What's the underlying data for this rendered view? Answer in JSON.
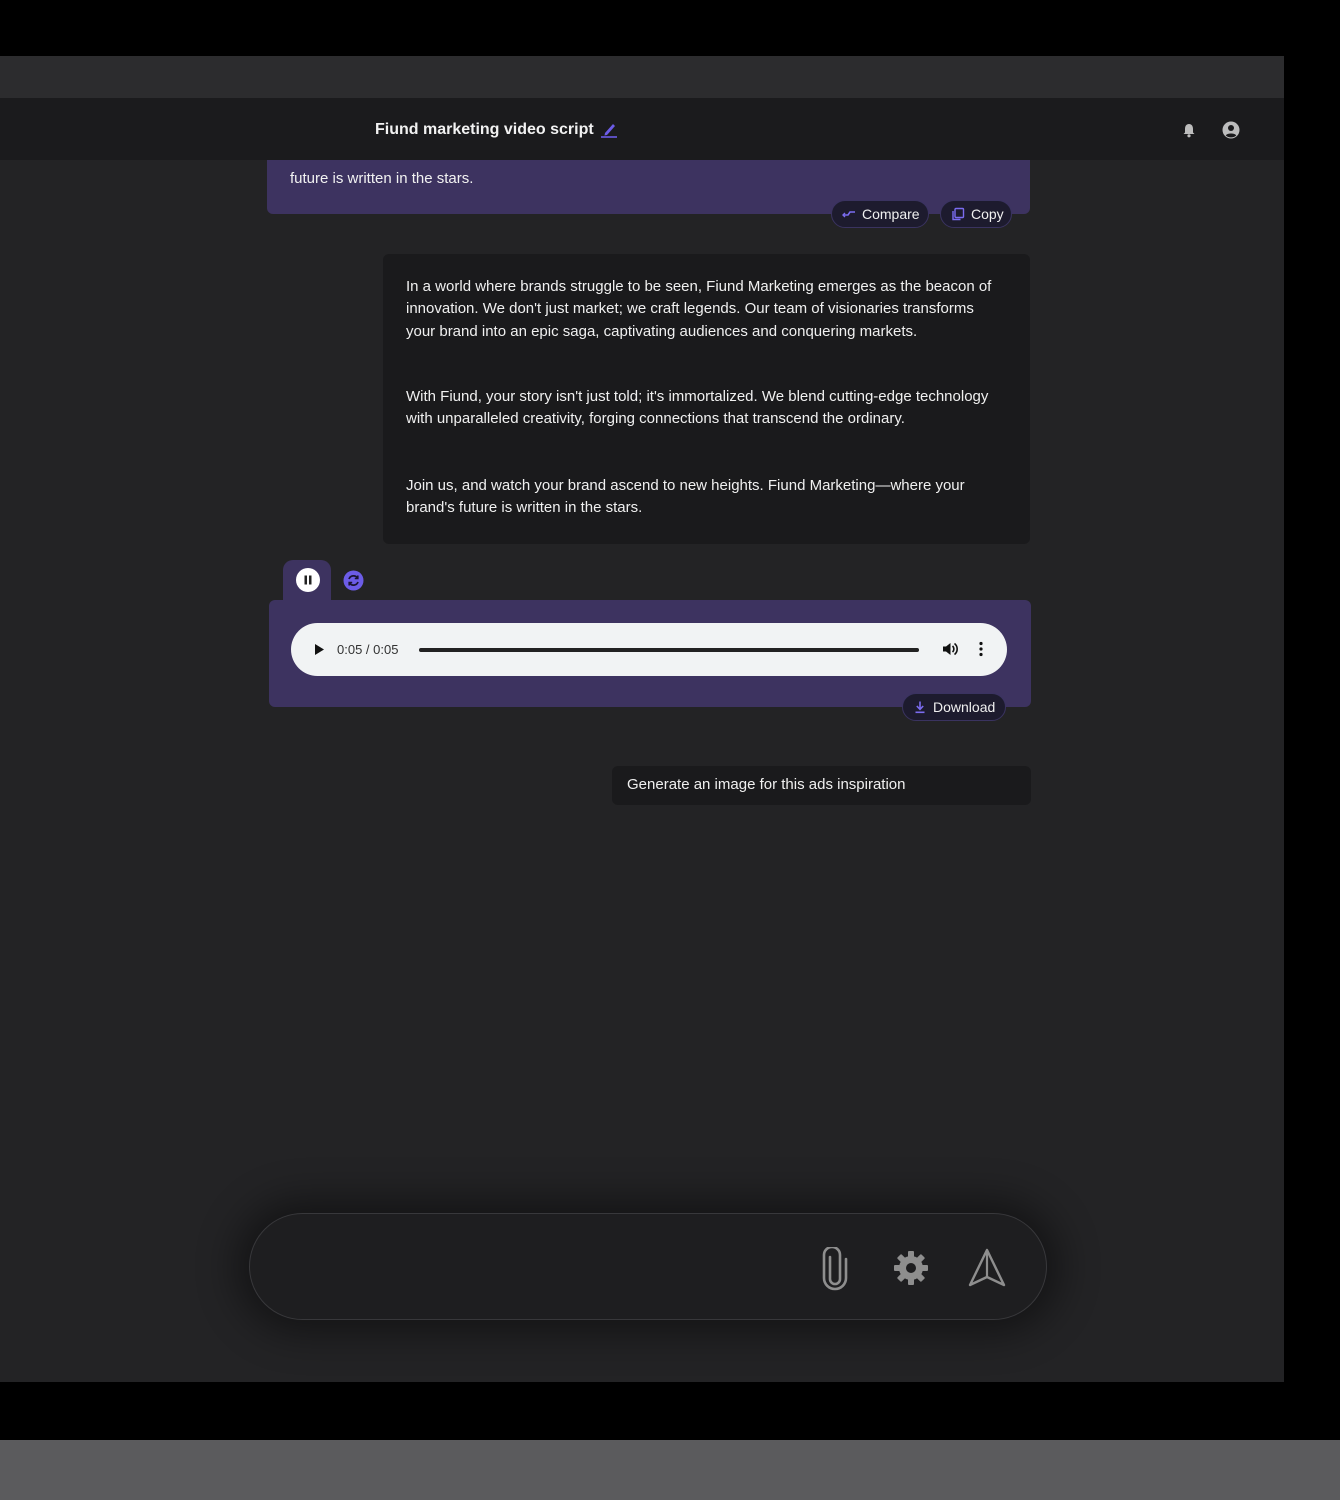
{
  "header": {
    "title": "Fiund marketing video script"
  },
  "previous_message": {
    "tail_text": "future is written in the stars.",
    "actions": {
      "compare_label": "Compare",
      "copy_label": "Copy"
    }
  },
  "response": {
    "paragraphs": [
      "In a world where brands struggle to be seen, Fiund Marketing emerges as the beacon of innovation. We don't just market; we craft legends. Our team of visionaries transforms your brand into an epic saga, captivating audiences and conquering markets.",
      "With Fiund, your story isn't just told; it's immortalized. We blend cutting-edge technology with unparalleled creativity, forging connections that transcend the ordinary.",
      "Join us, and watch your brand ascend to new heights. Fiund Marketing—where your brand's future is written in the stars."
    ]
  },
  "audio": {
    "time_display": "0:05 / 0:05",
    "progress": 1.0,
    "download_label": "Download"
  },
  "user_message": {
    "text": "Generate an image for this ads inspiration"
  },
  "composer": {
    "placeholder": ""
  },
  "colors": {
    "accent": "#6c5ce7",
    "bubble_purple": "#3d3360",
    "app_bg": "#232325",
    "header_bg": "#1b1b1d"
  },
  "icons": {
    "edit": "pencil-icon",
    "notifications": "bell-icon",
    "account": "user-circle-icon",
    "compare": "compare-icon",
    "copy": "copy-icon",
    "pause": "pause-icon",
    "regenerate": "refresh-icon",
    "play": "play-icon",
    "volume": "volume-icon",
    "more": "more-vertical-icon",
    "download": "download-icon",
    "attach": "paperclip-icon",
    "settings": "gear-icon",
    "send": "send-icon"
  }
}
